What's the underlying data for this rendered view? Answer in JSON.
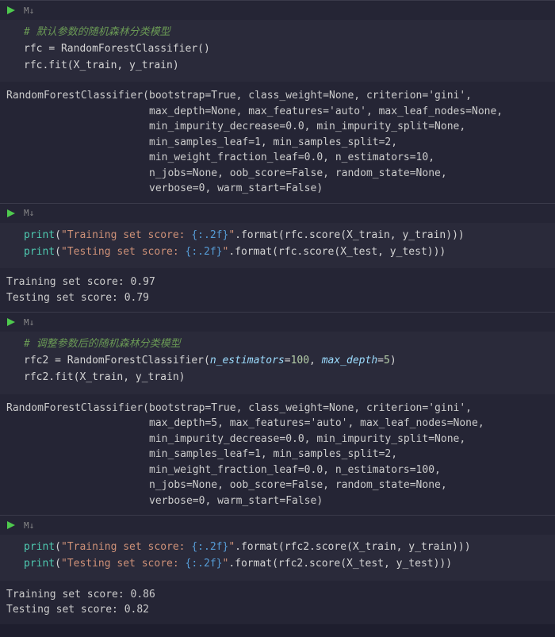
{
  "cells": [
    {
      "md_label": "M↓",
      "code_html": "<span class='comment'># 默认参数的随机森林分类模型</span>\nrfc <span class='op'>=</span> RandomForestClassifier()\nrfc.fit(X_train, y_train)",
      "output": "RandomForestClassifier(bootstrap=True, class_weight=None, criterion='gini',\n                       max_depth=None, max_features='auto', max_leaf_nodes=None,\n                       min_impurity_decrease=0.0, min_impurity_split=None,\n                       min_samples_leaf=1, min_samples_split=2,\n                       min_weight_fraction_leaf=0.0, n_estimators=10,\n                       n_jobs=None, oob_score=False, random_state=None,\n                       verbose=0, warm_start=False)"
    },
    {
      "md_label": "M↓",
      "code_html": "<span class='builtin'>print</span>(<span class='str'>\"Training set score: </span><span class='strfmt'>{:.2f}</span><span class='str'>\"</span>.format(rfc.score(X_train, y_train)))\n<span class='builtin'>print</span>(<span class='str'>\"Testing set score: </span><span class='strfmt'>{:.2f}</span><span class='str'>\"</span>.format(rfc.score(X_test, y_test)))",
      "output": "Training set score: 0.97\nTesting set score: 0.79"
    },
    {
      "md_label": "M↓",
      "code_html": "<span class='comment'># 调整参数后的随机森林分类模型</span>\nrfc2 <span class='op'>=</span> RandomForestClassifier(<span class='kwarg'>n_estimators</span><span class='op'>=</span><span class='num'>100</span>, <span class='kwarg'>max_depth</span><span class='op'>=</span><span class='num'>5</span>)\nrfc2.fit(X_train, y_train)",
      "output": "RandomForestClassifier(bootstrap=True, class_weight=None, criterion='gini',\n                       max_depth=5, max_features='auto', max_leaf_nodes=None,\n                       min_impurity_decrease=0.0, min_impurity_split=None,\n                       min_samples_leaf=1, min_samples_split=2,\n                       min_weight_fraction_leaf=0.0, n_estimators=100,\n                       n_jobs=None, oob_score=False, random_state=None,\n                       verbose=0, warm_start=False)"
    },
    {
      "md_label": "M↓",
      "code_html": "<span class='builtin'>print</span>(<span class='str'>\"Training set score: </span><span class='strfmt'>{:.2f}</span><span class='str'>\"</span>.format(rfc2.score(X_train, y_train)))\n<span class='builtin'>print</span>(<span class='str'>\"Testing set score: </span><span class='strfmt'>{:.2f}</span><span class='str'>\"</span>.format(rfc2.score(X_test, y_test)))",
      "output": "Training set score: 0.86\nTesting set score: 0.82"
    }
  ],
  "colors": {
    "run_icon": "#4ec94e"
  }
}
